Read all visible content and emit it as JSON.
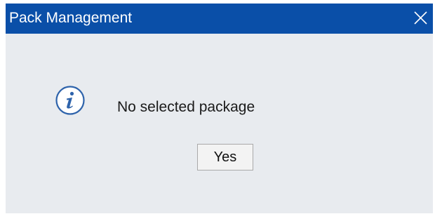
{
  "dialog": {
    "title": "Pack Management",
    "message": "No selected package",
    "yes_label": "Yes",
    "icon": "info-icon",
    "close_icon": "close-icon"
  },
  "colors": {
    "titlebar": "#0a4fa8",
    "dialog_background": "#e8ebef",
    "icon_accent": "#2e63ab"
  }
}
